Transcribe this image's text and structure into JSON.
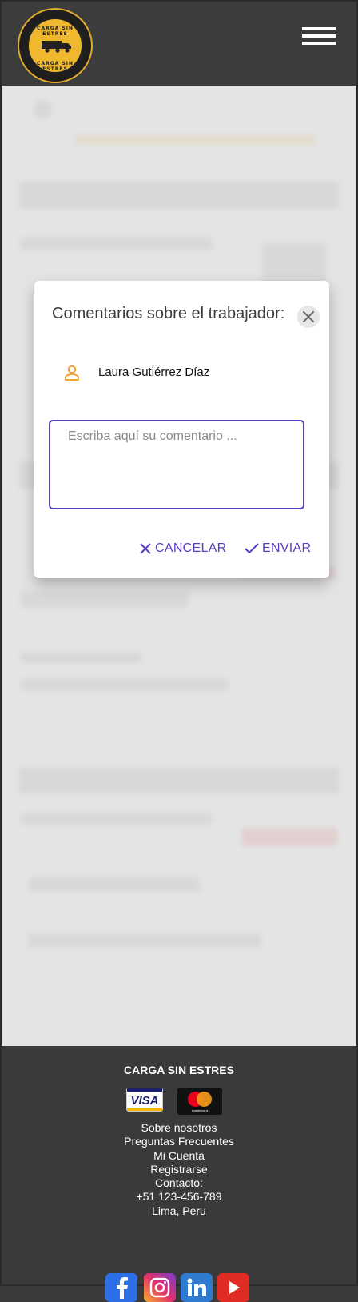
{
  "header": {
    "logo_text_top": "CARGA SIN ESTRES",
    "logo_text_bottom": "CARGA SIN ESTRES",
    "menu_icon": "hamburger-menu-icon"
  },
  "modal": {
    "title": "Comentarios sobre el trabajador:",
    "close_icon": "close-icon",
    "worker_icon": "person-icon",
    "worker_name": "Laura Gutiérrez Díaz",
    "comment_placeholder": "Escriba aquí su comentario ...",
    "comment_value": "",
    "cancel_label": "CANCELAR",
    "send_label": "ENVIAR",
    "accent_color": "#5b3cc4",
    "icon_color": "#efa43a"
  },
  "footer": {
    "brand": "CARGA SIN ESTRES",
    "cards": [
      "VISA",
      "mastercard"
    ],
    "links": [
      "Sobre nosotros",
      "Preguntas Frecuentes",
      "Mi Cuenta",
      "Registrarse",
      "Contacto:",
      "+51 123-456-789",
      "Lima, Peru"
    ],
    "social": [
      "facebook-icon",
      "instagram-icon",
      "linkedin-icon",
      "youtube-icon"
    ]
  }
}
